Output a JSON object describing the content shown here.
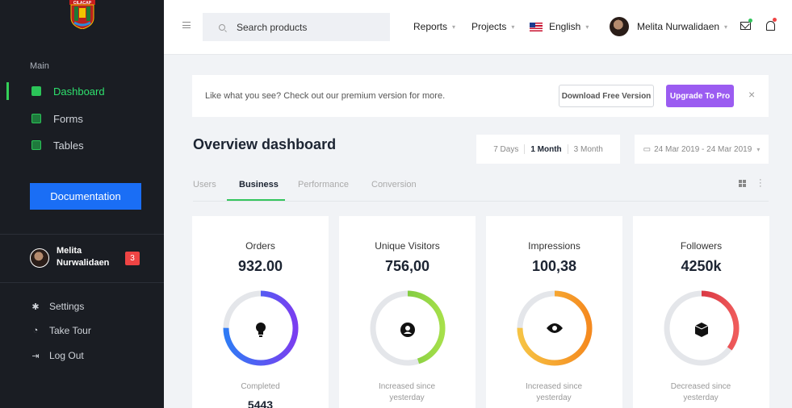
{
  "sidebar": {
    "logo_text": "CILACAP",
    "section_label": "Main",
    "items": [
      {
        "label": "Dashboard"
      },
      {
        "label": "Forms"
      },
      {
        "label": "Tables"
      }
    ],
    "documentation_label": "Documentation",
    "user_name": "Melita Nurwalidaen",
    "badge_count": "3",
    "bottom_items": [
      {
        "label": "Settings",
        "icon": "gear-icon"
      },
      {
        "label": "Take Tour",
        "icon": "compass-icon"
      },
      {
        "label": "Log Out",
        "icon": "logout-icon"
      }
    ]
  },
  "topbar": {
    "search_placeholder": "Search products",
    "reports_label": "Reports",
    "projects_label": "Projects",
    "language_label": "English",
    "user_name": "Melita Nurwalidaen"
  },
  "promo": {
    "text": "Like what you see? Check out our premium version for more.",
    "download_label": "Download Free Version",
    "upgrade_label": "Upgrade To Pro",
    "close_glyph": "×"
  },
  "overview": {
    "title": "Overview dashboard",
    "ranges": [
      "7 Days",
      "1 Month",
      "3 Month"
    ],
    "date_range": "24 Mar 2019 - 24 Mar 2019"
  },
  "tabs": [
    "Users",
    "Business",
    "Performance",
    "Conversion"
  ],
  "cards": [
    {
      "title": "Orders",
      "value": "932.00",
      "foot": "Completed",
      "foot_value": "5443",
      "icon": "lightbulb-icon",
      "progress": 0.75,
      "colors": [
        "#2f7bf5",
        "#7a3ef0"
      ]
    },
    {
      "title": "Unique Visitors",
      "value": "756,00",
      "foot": "Increased since yesterday",
      "foot_value": "",
      "icon": "user-circle-icon",
      "progress": 0.45,
      "colors": [
        "#5fb83a",
        "#a6e04a"
      ]
    },
    {
      "title": "Impressions",
      "value": "100,38",
      "foot": "Increased since yesterday",
      "foot_value": "",
      "icon": "eye-icon",
      "progress": 0.75,
      "colors": [
        "#f6c344",
        "#f58a1f"
      ]
    },
    {
      "title": "Followers",
      "value": "4250k",
      "foot": "Decreased since yesterday",
      "foot_value": "",
      "icon": "cube-icon",
      "progress": 0.35,
      "colors": [
        "#c4142b",
        "#ef5b5b"
      ]
    }
  ],
  "colors": {
    "accent_green": "#34c55d",
    "primary_blue": "#1a6ef5",
    "pro_purple": "#9b5cf1",
    "badge_red": "#ef4444"
  }
}
